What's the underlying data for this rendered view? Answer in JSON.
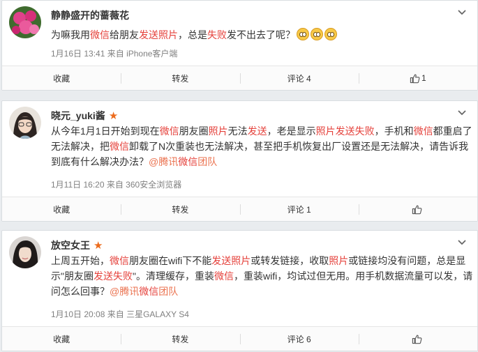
{
  "posts": [
    {
      "username": "静静盛开的蔷薇花",
      "verified_star": false,
      "text_segments": [
        {
          "t": "为嘛我用",
          "s": "plain"
        },
        {
          "t": "微信",
          "s": "hl"
        },
        {
          "t": "给朋友",
          "s": "plain"
        },
        {
          "t": "发送照片",
          "s": "hl"
        },
        {
          "t": "，总是",
          "s": "plain"
        },
        {
          "t": "失败",
          "s": "hl"
        },
        {
          "t": "发不出去了呢？",
          "s": "plain"
        }
      ],
      "emoji_count": 3,
      "emoji_icon": "awkward-face-emoji",
      "timestamp": "1月16日 13:41",
      "source": "来自 iPhone客户端",
      "actions": {
        "collect": "收藏",
        "repost": "转发",
        "comment": "评论 4",
        "like_count": "1"
      }
    },
    {
      "username": "晓元_yuki酱",
      "verified_star": true,
      "text_segments": [
        {
          "t": "从今年1月1日开始到现在",
          "s": "plain"
        },
        {
          "t": "微信",
          "s": "hl"
        },
        {
          "t": "朋友圈",
          "s": "plain"
        },
        {
          "t": "照片",
          "s": "hl"
        },
        {
          "t": "无法",
          "s": "plain"
        },
        {
          "t": "发送",
          "s": "hl"
        },
        {
          "t": "，老是显示",
          "s": "plain"
        },
        {
          "t": "照片发送失败",
          "s": "hl"
        },
        {
          "t": "，手机和",
          "s": "plain"
        },
        {
          "t": "微信",
          "s": "hl"
        },
        {
          "t": "都重启了无法解决，把",
          "s": "plain"
        },
        {
          "t": "微信",
          "s": "hl"
        },
        {
          "t": "卸载了N次重装也无法解决，甚至把手机恢复出厂设置还是无法解决，请告诉我到底有什么解决办法？",
          "s": "plain"
        },
        {
          "t": "@腾讯",
          "s": "mention"
        },
        {
          "t": "微信",
          "s": "hl"
        },
        {
          "t": "团队",
          "s": "mention"
        }
      ],
      "emoji_count": 0,
      "timestamp": "1月11日 16:20",
      "source": "来自 360安全浏览器",
      "actions": {
        "collect": "收藏",
        "repost": "转发",
        "comment": "评论 1",
        "like_count": ""
      }
    },
    {
      "username": "放空女王",
      "verified_star": true,
      "text_segments": [
        {
          "t": "上周五开始，",
          "s": "plain"
        },
        {
          "t": "微信",
          "s": "hl"
        },
        {
          "t": "朋友圈在wifi下不能",
          "s": "plain"
        },
        {
          "t": "发送照片",
          "s": "hl"
        },
        {
          "t": "或转发链接，收取",
          "s": "plain"
        },
        {
          "t": "照片",
          "s": "hl"
        },
        {
          "t": "或链接均没有问题，总是显示\"朋友圈",
          "s": "plain"
        },
        {
          "t": "发送失败",
          "s": "hl"
        },
        {
          "t": "\"。清理缓存，重装",
          "s": "plain"
        },
        {
          "t": "微信",
          "s": "hl"
        },
        {
          "t": "，重装wifi，均试过但无用。用手机数据流量可以发，请问怎么回事？",
          "s": "plain"
        },
        {
          "t": "@腾讯",
          "s": "mention"
        },
        {
          "t": "微信",
          "s": "hl"
        },
        {
          "t": "团队",
          "s": "mention"
        }
      ],
      "emoji_count": 0,
      "timestamp": "1月10日 20:08",
      "source": "来自 三星GALAXY S4",
      "actions": {
        "collect": "收藏",
        "repost": "转发",
        "comment": "评论 6",
        "like_count": ""
      }
    }
  ],
  "icons": {
    "star": "star-icon",
    "chevron": "chevron-down-icon",
    "like": "thumbs-up-icon"
  },
  "colors": {
    "highlight": "#e5413b",
    "mention": "#eb7350",
    "star": "#ec6b1c",
    "meta": "#808080"
  }
}
